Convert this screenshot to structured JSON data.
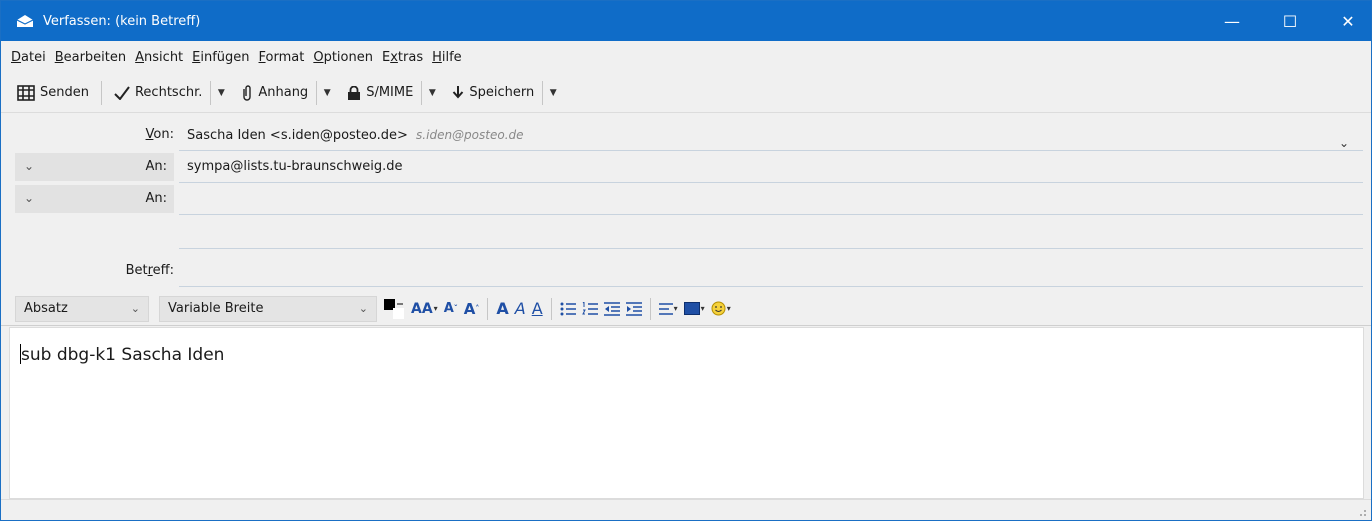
{
  "window": {
    "title": "Verfassen: (kein Betreff)",
    "controls": {
      "minimize": "—",
      "maximize": "☐",
      "close": "✕"
    }
  },
  "menu": [
    {
      "acc": "D",
      "rest": "atei"
    },
    {
      "acc": "B",
      "rest": "earbeiten"
    },
    {
      "acc": "A",
      "rest": "nsicht"
    },
    {
      "acc": "E",
      "rest": "infügen"
    },
    {
      "acc": "F",
      "rest": "ormat"
    },
    {
      "acc": "O",
      "rest": "ptionen"
    },
    {
      "pre": "E",
      "acc": "x",
      "rest": "tras"
    },
    {
      "acc": "H",
      "rest": "ilfe"
    }
  ],
  "toolbar": {
    "send": "Senden",
    "spellcheck": "Rechtschr.",
    "attach": "Anhang",
    "smime": "S/MIME",
    "save": "Speichern"
  },
  "fields": {
    "from_label_acc": "V",
    "from_label_rest": "on:",
    "from_value": "Sascha Iden <s.iden@posteo.de>",
    "from_hint": "s.iden@posteo.de",
    "to1_label": "An:",
    "to1_value": "sympa@lists.tu-braunschweig.de",
    "to2_label": "An:",
    "to2_value": "",
    "subject_label_pre": "Bet",
    "subject_label_acc": "r",
    "subject_label_rest": "eff:",
    "subject_value": ""
  },
  "format": {
    "paragraph": "Absatz",
    "font": "Variable Breite"
  },
  "editor": {
    "text": "sub dbg-k1 Sascha Iden"
  },
  "colors": {
    "titlebar": "#0f6cc8",
    "format_icons": "#1f4fa5"
  }
}
